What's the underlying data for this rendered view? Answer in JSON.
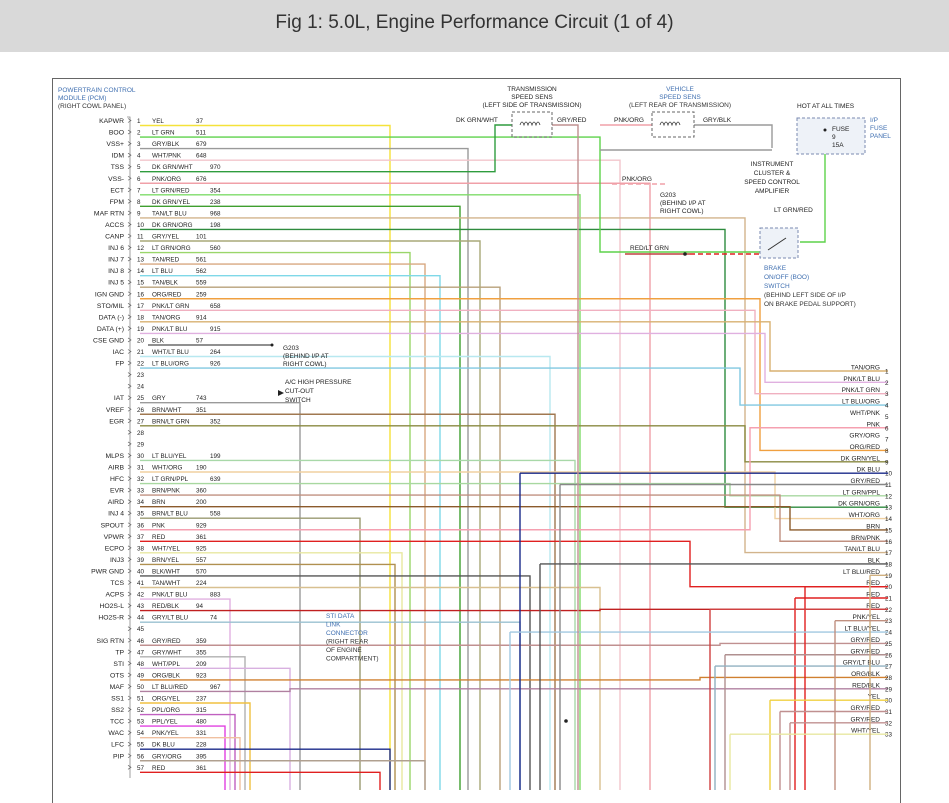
{
  "header": {
    "title": "Fig 1: 5.0L, Engine Performance Circuit (1 of 4)"
  },
  "pcm": {
    "lines": [
      "POWERTRAIN CONTROL",
      "MODULE (PCM)",
      "(RIGHT COWL PANEL)"
    ]
  },
  "pins": [
    {
      "num": "1",
      "func": "KAPWR",
      "wire": "YEL",
      "circuit": "37",
      "color": "#f5e23a"
    },
    {
      "num": "2",
      "func": "BOO",
      "wire": "LT GRN",
      "circuit": "511",
      "color": "#5dd24a"
    },
    {
      "num": "3",
      "func": "VSS+",
      "wire": "GRY/BLK",
      "circuit": "679",
      "color": "#9a9a9a"
    },
    {
      "num": "4",
      "func": "IDM",
      "wire": "WHT/PNK",
      "circuit": "648",
      "color": "#f2c6cc"
    },
    {
      "num": "5",
      "func": "TSS",
      "wire": "DK GRN/WHT",
      "circuit": "970",
      "color": "#2f9c3e"
    },
    {
      "num": "6",
      "func": "VSS-",
      "wire": "PNK/ORG",
      "circuit": "676",
      "color": "#f0a0a8"
    },
    {
      "num": "7",
      "func": "ECT",
      "wire": "LT GRN/RED",
      "circuit": "354",
      "color": "#7fdc6a"
    },
    {
      "num": "8",
      "func": "FPM",
      "wire": "DK GRN/YEL",
      "circuit": "238",
      "color": "#3f9f2f"
    },
    {
      "num": "9",
      "func": "MAF RTN",
      "wire": "TAN/LT BLU",
      "circuit": "968",
      "color": "#d2b48c"
    },
    {
      "num": "10",
      "func": "ACCS",
      "wire": "DK GRN/ORG",
      "circuit": "198",
      "color": "#2e8b3e"
    },
    {
      "num": "11",
      "func": "CANP",
      "wire": "GRY/YEL",
      "circuit": "101",
      "color": "#a8a878"
    },
    {
      "num": "12",
      "func": "INJ 6",
      "wire": "LT GRN/ORG",
      "circuit": "560",
      "color": "#9ad66a"
    },
    {
      "num": "13",
      "func": "INJ 7",
      "wire": "TAN/RED",
      "circuit": "561",
      "color": "#d8a880"
    },
    {
      "num": "14",
      "func": "INJ 8",
      "wire": "LT BLU",
      "circuit": "562",
      "color": "#7fd8e8"
    },
    {
      "num": "15",
      "func": "INJ 5",
      "wire": "TAN/BLK",
      "circuit": "559",
      "color": "#b8a07a"
    },
    {
      "num": "16",
      "func": "IGN GND",
      "wire": "ORG/RED",
      "circuit": "259",
      "color": "#f0a040"
    },
    {
      "num": "17",
      "func": "STO/MIL",
      "wire": "PNK/LT GRN",
      "circuit": "658",
      "color": "#f0b0c0"
    },
    {
      "num": "18",
      "func": "DATA (-)",
      "wire": "TAN/ORG",
      "circuit": "914",
      "color": "#d8b070"
    },
    {
      "num": "19",
      "func": "DATA (+)",
      "wire": "PNK/LT BLU",
      "circuit": "915",
      "color": "#e0b0e0"
    },
    {
      "num": "20",
      "func": "CSE GND",
      "wire": "BLK",
      "circuit": "57",
      "color": "#222222"
    },
    {
      "num": "21",
      "func": "IAC",
      "wire": "WHT/LT BLU",
      "circuit": "264",
      "color": "#b8e8f0"
    },
    {
      "num": "22",
      "func": "FP",
      "wire": "LT BLU/ORG",
      "circuit": "926",
      "color": "#80c8e0"
    },
    {
      "num": "23",
      "func": "",
      "wire": "",
      "circuit": "",
      "color": ""
    },
    {
      "num": "24",
      "func": "",
      "wire": "",
      "circuit": "",
      "color": ""
    },
    {
      "num": "25",
      "func": "IAT",
      "wire": "GRY",
      "circuit": "743",
      "color": "#9a9a9a"
    },
    {
      "num": "26",
      "func": "VREF",
      "wire": "BRN/WHT",
      "circuit": "351",
      "color": "#a07850"
    },
    {
      "num": "27",
      "func": "EGR",
      "wire": "BRN/LT GRN",
      "circuit": "352",
      "color": "#8a8a40"
    },
    {
      "num": "28",
      "func": "",
      "wire": "",
      "circuit": "",
      "color": ""
    },
    {
      "num": "29",
      "func": "",
      "wire": "",
      "circuit": "",
      "color": ""
    },
    {
      "num": "30",
      "func": "MLPS",
      "wire": "LT BLU/YEL",
      "circuit": "199",
      "color": "#a8d8a8"
    },
    {
      "num": "31",
      "func": "AIRB",
      "wire": "WHT/ORG",
      "circuit": "190",
      "color": "#f0d0a0"
    },
    {
      "num": "32",
      "func": "HFC",
      "wire": "LT GRN/PPL",
      "circuit": "639",
      "color": "#a8d8a0"
    },
    {
      "num": "33",
      "func": "EVR",
      "wire": "BRN/PNK",
      "circuit": "360",
      "color": "#c09080"
    },
    {
      "num": "34",
      "func": "AIRD",
      "wire": "BRN",
      "circuit": "200",
      "color": "#8b5a2b"
    },
    {
      "num": "35",
      "func": "INJ 4",
      "wire": "BRN/LT BLU",
      "circuit": "558",
      "color": "#9a9a70"
    },
    {
      "num": "36",
      "func": "SPOUT",
      "wire": "PNK",
      "circuit": "929",
      "color": "#f5a0b0"
    },
    {
      "num": "37",
      "func": "VPWR",
      "wire": "RED",
      "circuit": "361",
      "color": "#e02020"
    },
    {
      "num": "38",
      "func": "ECPO",
      "wire": "WHT/YEL",
      "circuit": "925",
      "color": "#e8e8a0"
    },
    {
      "num": "39",
      "func": "INJ3",
      "wire": "BRN/YEL",
      "circuit": "557",
      "color": "#b09050"
    },
    {
      "num": "40",
      "func": "PWR GND",
      "wire": "BLK/WHT",
      "circuit": "570",
      "color": "#555555"
    },
    {
      "num": "41",
      "func": "TCS",
      "wire": "TAN/WHT",
      "circuit": "224",
      "color": "#d8c090"
    },
    {
      "num": "42",
      "func": "ACPS",
      "wire": "PNK/LT BLU",
      "circuit": "883",
      "color": "#e0b0e0"
    },
    {
      "num": "43",
      "func": "HO2S-L",
      "wire": "RED/BLK",
      "circuit": "94",
      "color": "#c02020"
    },
    {
      "num": "44",
      "func": "HO2S-R",
      "wire": "GRY/LT BLU",
      "circuit": "74",
      "color": "#9ac0d0"
    },
    {
      "num": "45",
      "func": "",
      "wire": "",
      "circuit": "",
      "color": ""
    },
    {
      "num": "46",
      "func": "SIG RTN",
      "wire": "GRY/RED",
      "circuit": "359",
      "color": "#c09090"
    },
    {
      "num": "47",
      "func": "TP",
      "wire": "GRY/WHT",
      "circuit": "355",
      "color": "#b0b0b0"
    },
    {
      "num": "48",
      "func": "STI",
      "wire": "WHT/PPL",
      "circuit": "209",
      "color": "#d8b0e0"
    },
    {
      "num": "49",
      "func": "OTS",
      "wire": "ORG/BLK",
      "circuit": "923",
      "color": "#d08030"
    },
    {
      "num": "50",
      "func": "MAF",
      "wire": "LT BLU/RED",
      "circuit": "967",
      "color": "#b080a0"
    },
    {
      "num": "51",
      "func": "SS1",
      "wire": "ORG/YEL",
      "circuit": "237",
      "color": "#f0c040"
    },
    {
      "num": "52",
      "func": "SS2",
      "wire": "PPL/ORG",
      "circuit": "315",
      "color": "#c060c0"
    },
    {
      "num": "53",
      "func": "TCC",
      "wire": "PPL/YEL",
      "circuit": "480",
      "color": "#e040e0"
    },
    {
      "num": "54",
      "func": "WAC",
      "wire": "PNK/YEL",
      "circuit": "331",
      "color": "#f0c0a0"
    },
    {
      "num": "55",
      "func": "LFC",
      "wire": "DK BLU",
      "circuit": "228",
      "color": "#1a2a8a"
    },
    {
      "num": "56",
      "func": "PIP",
      "wire": "GRY/ORG",
      "circuit": "395",
      "color": "#b0a090"
    },
    {
      "num": "57",
      "func": "",
      "wire": "RED",
      "circuit": "361",
      "color": "#e02020"
    }
  ],
  "right_terms": [
    {
      "num": "1",
      "label": "TAN/ORG"
    },
    {
      "num": "2",
      "label": "PNK/LT BLU"
    },
    {
      "num": "3",
      "label": "PNK/LT GRN"
    },
    {
      "num": "4",
      "label": "LT BLU/ORG"
    },
    {
      "num": "5",
      "label": "WHT/PNK"
    },
    {
      "num": "6",
      "label": "PNK"
    },
    {
      "num": "7",
      "label": "GRY/ORG"
    },
    {
      "num": "8",
      "label": "ORG/RED"
    },
    {
      "num": "9",
      "label": "DK GRN/YEL"
    },
    {
      "num": "10",
      "label": "DK BLU"
    },
    {
      "num": "11",
      "label": "GRY/RED"
    },
    {
      "num": "12",
      "label": "LT GRN/PPL"
    },
    {
      "num": "13",
      "label": "DK GRN/ORG"
    },
    {
      "num": "14",
      "label": "WHT/ORG"
    },
    {
      "num": "15",
      "label": "BRN"
    },
    {
      "num": "16",
      "label": "BRN/PNK"
    },
    {
      "num": "17",
      "label": "TAN/LT BLU"
    },
    {
      "num": "18",
      "label": "BLK"
    },
    {
      "num": "19",
      "label": "LT BLU/RED"
    },
    {
      "num": "20",
      "label": "RED"
    },
    {
      "num": "21",
      "label": "RED"
    },
    {
      "num": "22",
      "label": "RED"
    },
    {
      "num": "23",
      "label": "PNK/YEL"
    },
    {
      "num": "24",
      "label": "LT BLU/YEL"
    },
    {
      "num": "25",
      "label": "GRY/RED"
    },
    {
      "num": "26",
      "label": "GRY/RED"
    },
    {
      "num": "27",
      "label": "GRY/LT BLU"
    },
    {
      "num": "28",
      "label": "ORG/BLK"
    },
    {
      "num": "29",
      "label": "RED/BLK"
    },
    {
      "num": "30",
      "label": "YEL"
    },
    {
      "num": "31",
      "label": "GRY/RED"
    },
    {
      "num": "32",
      "label": "GRY/RED"
    },
    {
      "num": "33",
      "label": "WHT/YEL"
    }
  ],
  "components": {
    "tss": [
      "TRANSMISSION",
      "SPEED SENS",
      "(LEFT SIDE OF TRANSMISSION)"
    ],
    "vss": [
      "VEHICLE",
      "SPEED SENS",
      "(LEFT REAR OF TRANSMISSION)"
    ],
    "hot": "HOT AT ALL TIMES",
    "fuse": [
      "FUSE",
      "9",
      "15A"
    ],
    "fuse_panel": [
      "I/P",
      "FUSE",
      "PANEL"
    ],
    "cluster": [
      "INSTRUMENT",
      "CLUSTER &",
      "SPEED CONTROL",
      "AMPLIFIER"
    ],
    "g203a": [
      "G203",
      "(BEHIND I/P AT",
      "RIGHT COWL)"
    ],
    "g203b": [
      "G203",
      "(BEHIND I/P AT",
      "RIGHT COWL)"
    ],
    "boo": [
      "BRAKE",
      "ON/OFF (BOO)",
      "SWITCH",
      "(BEHIND LEFT SIDE OF I/P",
      "ON BRAKE PEDAL SUPPORT)"
    ],
    "ac": [
      "A/C HIGH PRESSURE",
      "CUT-OUT",
      "SWITCH"
    ],
    "sti": [
      "STI DATA",
      "LINK",
      "CONNECTOR",
      "(RIGHT REAR",
      "OF ENGINE",
      "COMPARTMENT)"
    ]
  },
  "wire_labels": {
    "dk_grn_wht": "DK GRN/WHT",
    "gry_red": "GRY/RED",
    "pnk_org": "PNK/ORG",
    "gry_blk": "GRY/BLK",
    "pnk_org2": "PNK/ORG",
    "lt_grn_red": "LT GRN/RED",
    "red_lt_grn": "RED/LT GRN"
  }
}
